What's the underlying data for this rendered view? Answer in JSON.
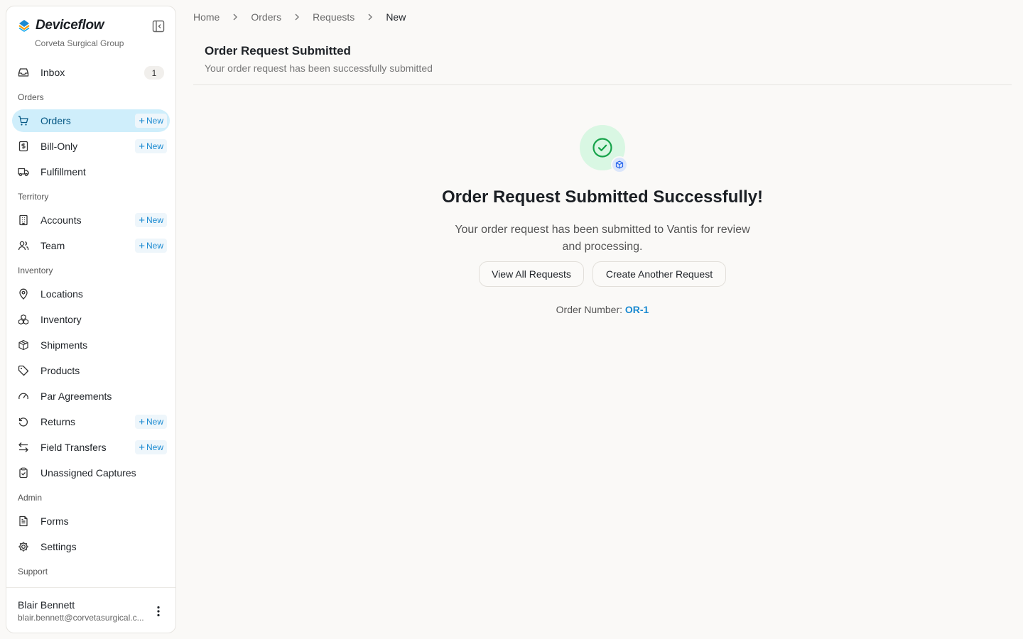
{
  "brand": {
    "name": "Deviceflow",
    "org": "Corveta Surgical Group"
  },
  "sidebar": {
    "inbox": {
      "label": "Inbox",
      "count": "1"
    },
    "sections": {
      "orders": "Orders",
      "territory": "Territory",
      "inventory": "Inventory",
      "admin": "Admin",
      "support": "Support"
    },
    "new_label": "New",
    "items": {
      "orders": "Orders",
      "bill_only": "Bill-Only",
      "fulfillment": "Fulfillment",
      "accounts": "Accounts",
      "team": "Team",
      "locations": "Locations",
      "inventory": "Inventory",
      "shipments": "Shipments",
      "products": "Products",
      "par_agreements": "Par Agreements",
      "returns": "Returns",
      "field_transfers": "Field Transfers",
      "unassigned_captures": "Unassigned Captures",
      "forms": "Forms",
      "settings": "Settings"
    },
    "active_item": "orders"
  },
  "user": {
    "name": "Blair Bennett",
    "email": "blair.bennett@corvetasurgical.c..."
  },
  "breadcrumb": [
    "Home",
    "Orders",
    "Requests",
    "New"
  ],
  "header": {
    "title": "Order Request Submitted",
    "subtitle": "Your order request has been successfully submitted"
  },
  "success": {
    "title": "Order Request Submitted Successfully!",
    "message": "Your order request has been submitted to Vantis for review and processing.",
    "view_all_label": "View All Requests",
    "create_another_label": "Create Another Request",
    "order_number_label": "Order Number:",
    "order_number": "OR-1"
  },
  "colors": {
    "accent": "#1a8ad1",
    "active_bg": "#cfeefb",
    "success_bg": "#d9f7e3",
    "success": "#16a34a"
  }
}
